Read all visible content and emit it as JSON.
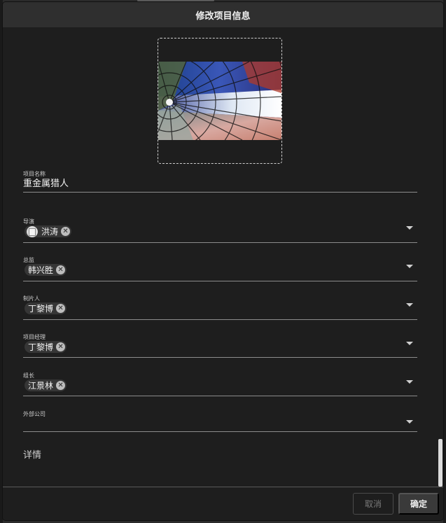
{
  "dialog": {
    "title": "修改项目信息",
    "cover": {
      "alt": "项目封面",
      "icon": "cover-image"
    }
  },
  "fields": {
    "project_name": {
      "label": "项目名称",
      "value": "重金属猎人"
    },
    "director": {
      "label": "导演",
      "chips": [
        "洪涛"
      ],
      "has_avatar": true
    },
    "supervisor": {
      "label": "总监",
      "chips": [
        "韩兴胜"
      ]
    },
    "producer": {
      "label": "制片人",
      "chips": [
        "丁黎博"
      ]
    },
    "project_manager": {
      "label": "项目经理",
      "chips": [
        "丁黎博"
      ]
    },
    "team_lead": {
      "label": "组长",
      "chips": [
        "江景林"
      ]
    },
    "external_company": {
      "label": "外部公司",
      "chips": []
    }
  },
  "details": {
    "title": "详情"
  },
  "footer": {
    "cancel_label": "取消",
    "confirm_label": "确定"
  },
  "icons": {
    "dropdown": "chevron-down-icon",
    "chip_remove": "close-circle-icon",
    "avatar": "broken-avatar-icon"
  },
  "colors": {
    "dialog_bg": "#1e1e1e",
    "header_bg": "#2f2f2f",
    "chip_bg": "#363636",
    "underline": "#8c8c8c"
  }
}
